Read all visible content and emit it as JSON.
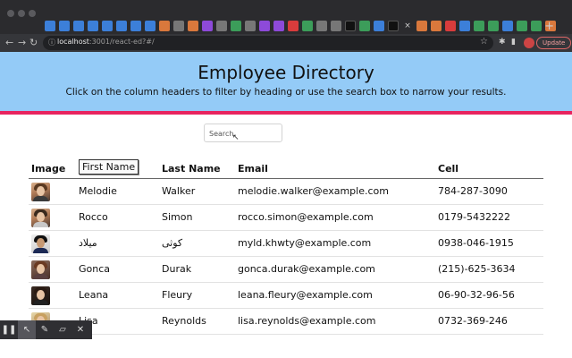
{
  "browser": {
    "url_host": "localhost",
    "url_path": ":3001/react-ed?#/",
    "update_label": "Update",
    "new_tab": "+",
    "tab_close": "×"
  },
  "header": {
    "title": "Employee Directory",
    "subtitle": "Click on the column headers to filter by heading or use the search box to narrow your results."
  },
  "search": {
    "placeholder": "Search"
  },
  "table": {
    "columns": [
      "Image",
      "First Name",
      "Last Name",
      "Email",
      "Cell"
    ],
    "rows": [
      {
        "first": "Melodie",
        "last": "Walker",
        "email": "melodie.walker@example.com",
        "cell": "784-287-3090"
      },
      {
        "first": "Rocco",
        "last": "Simon",
        "email": "rocco.simon@example.com",
        "cell": "0179-5432222"
      },
      {
        "first": "ميلاد",
        "last": "کوثی",
        "email": "myld.khwty@example.com",
        "cell": "0938-046-1915"
      },
      {
        "first": "Gonca",
        "last": "Durak",
        "email": "gonca.durak@example.com",
        "cell": "(215)-625-3634"
      },
      {
        "first": "Leana",
        "last": "Fleury",
        "email": "leana.fleury@example.com",
        "cell": "06-90-32-96-56"
      },
      {
        "first": "Lisa",
        "last": "Reynolds",
        "email": "lisa.reynolds@example.com",
        "cell": "0732-369-246"
      }
    ]
  },
  "recorder": {
    "buttons": [
      "pause-icon",
      "pointer-icon",
      "pen-icon",
      "highlighter-icon",
      "close-icon"
    ]
  },
  "colors": {
    "header_bg": "#94cbf7",
    "accent_bar": "#e8245f"
  }
}
